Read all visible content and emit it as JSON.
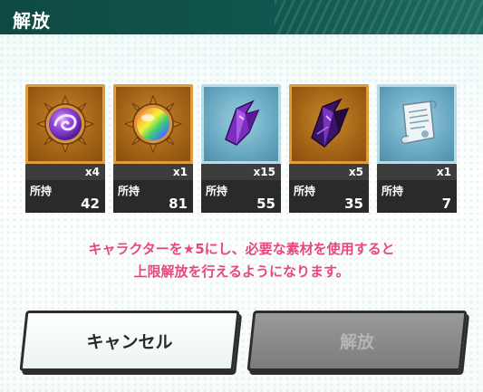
{
  "header": {
    "title": "解放"
  },
  "items": [
    {
      "icon": "purple-orb-icon",
      "frame": "gold",
      "required": "x4",
      "owned_label": "所持",
      "owned": "42"
    },
    {
      "icon": "rainbow-orb-icon",
      "frame": "gold",
      "required": "x1",
      "owned_label": "所持",
      "owned": "81"
    },
    {
      "icon": "purple-crystal-icon",
      "frame": "blue",
      "required": "x15",
      "owned_label": "所持",
      "owned": "55"
    },
    {
      "icon": "dark-crystal-icon",
      "frame": "gold",
      "required": "x5",
      "owned_label": "所持",
      "owned": "35"
    },
    {
      "icon": "scroll-icon",
      "frame": "blue",
      "required": "x1",
      "owned_label": "所持",
      "owned": "7"
    }
  ],
  "message": {
    "line1": "キャラクターを★5にし、必要な素材を使用すると",
    "line2": "上限解放を行えるようになります。"
  },
  "buttons": {
    "cancel": "キャンセル",
    "release": "解放"
  },
  "colors": {
    "header": "#11564e",
    "message": "#e8477a",
    "gold_frame": "#e09b3c",
    "blue_frame": "#b8dbe6"
  }
}
